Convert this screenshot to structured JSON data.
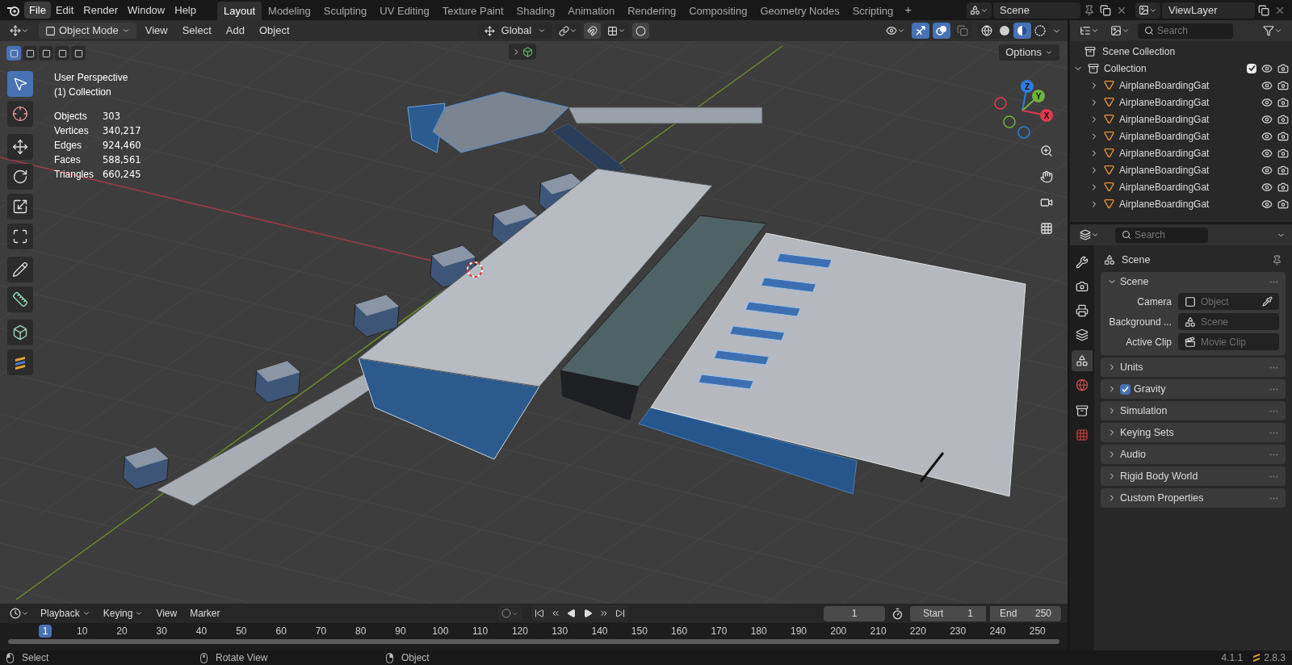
{
  "topbar": {
    "menus": [
      {
        "label": "File",
        "selected": true
      },
      {
        "label": "Edit",
        "selected": false
      },
      {
        "label": "Render",
        "selected": false
      },
      {
        "label": "Window",
        "selected": false
      },
      {
        "label": "Help",
        "selected": false
      }
    ],
    "workspaces": [
      {
        "label": "Layout",
        "selected": true
      },
      {
        "label": "Modeling",
        "selected": false
      },
      {
        "label": "Sculpting",
        "selected": false
      },
      {
        "label": "UV Editing",
        "selected": false
      },
      {
        "label": "Texture Paint",
        "selected": false
      },
      {
        "label": "Shading",
        "selected": false
      },
      {
        "label": "Animation",
        "selected": false
      },
      {
        "label": "Rendering",
        "selected": false
      },
      {
        "label": "Compositing",
        "selected": false
      },
      {
        "label": "Geometry Nodes",
        "selected": false
      },
      {
        "label": "Scripting",
        "selected": false
      }
    ],
    "add_tab": "+",
    "scene": "Scene",
    "view_layer": "ViewLayer"
  },
  "viewport": {
    "mode": "Object Mode",
    "menus": [
      "View",
      "Select",
      "Add",
      "Object"
    ],
    "orientation": "Global",
    "options": "Options",
    "select_modes": [
      {
        "selected": true
      },
      {
        "selected": false
      },
      {
        "selected": false
      },
      {
        "selected": false
      },
      {
        "selected": false
      }
    ],
    "toggles": [
      {
        "kind": "gizmo",
        "on": true
      },
      {
        "kind": "overlay",
        "on": true
      },
      {
        "kind": "xray",
        "on": false
      }
    ],
    "shading_modes": [
      {
        "kind": "wireframe",
        "selected": false
      },
      {
        "kind": "solid",
        "selected": false
      },
      {
        "kind": "material",
        "selected": true
      },
      {
        "kind": "rendered",
        "selected": false
      }
    ],
    "info": [
      "User Perspective",
      "(1) Collection"
    ],
    "stats": [
      {
        "label": "Objects",
        "value": "303"
      },
      {
        "label": "Vertices",
        "value": "340,217"
      },
      {
        "label": "Edges",
        "value": "924,460"
      },
      {
        "label": "Faces",
        "value": "588,561"
      },
      {
        "label": "Triangles",
        "value": "660,245"
      }
    ],
    "gizmo_axes": [
      {
        "label": "Z",
        "color": "#2f7be0"
      },
      {
        "label": "Y",
        "color": "#6fb33a"
      },
      {
        "label": "X",
        "color": "#e0394f"
      }
    ],
    "tools": [
      {
        "kind": "select",
        "selected": true
      },
      {
        "kind": "cursor",
        "selected": false
      },
      {
        "kind": "move",
        "selected": false
      },
      {
        "kind": "rotate",
        "selected": false
      },
      {
        "kind": "scale",
        "selected": false
      },
      {
        "kind": "transform",
        "selected": false
      },
      {
        "kind": "annotate",
        "selected": false
      },
      {
        "kind": "measure",
        "selected": false
      },
      {
        "kind": "add-cube",
        "selected": false
      },
      {
        "kind": "grease",
        "selected": false
      }
    ]
  },
  "outliner": {
    "search_placeholder": "Search",
    "root": "Scene Collection",
    "collection": {
      "name": "Collection",
      "expanded": true,
      "checked": true,
      "children": [
        {
          "name": "AirplaneBoardingGat",
          "expanded": false
        },
        {
          "name": "AirplaneBoardingGat",
          "expanded": false
        },
        {
          "name": "AirplaneBoardingGat",
          "expanded": false
        },
        {
          "name": "AirplaneBoardingGat",
          "expanded": false
        },
        {
          "name": "AirplaneBoardingGat",
          "expanded": false
        },
        {
          "name": "AirplaneBoardingGat",
          "expanded": false
        },
        {
          "name": "AirplaneBoardingGat",
          "expanded": false
        },
        {
          "name": "AirplaneBoardingGat",
          "expanded": false
        }
      ]
    }
  },
  "properties": {
    "search_placeholder": "Search",
    "title": "Scene",
    "tabs": [
      {
        "kind": "tool",
        "selected": false
      },
      {
        "kind": "render",
        "selected": false
      },
      {
        "kind": "output",
        "selected": false
      },
      {
        "kind": "view-layer",
        "selected": false
      },
      {
        "kind": "scene",
        "selected": true
      },
      {
        "kind": "world",
        "selected": false
      },
      {
        "kind": "collection",
        "selected": false
      },
      {
        "kind": "texture",
        "selected": false
      }
    ],
    "panels": [
      {
        "title": "Scene",
        "expanded": true,
        "fields": [
          {
            "label": "Camera",
            "placeholder": "Object",
            "kind": "object"
          },
          {
            "label": "Background ...",
            "placeholder": "Scene",
            "kind": "scene"
          },
          {
            "label": "Active Clip",
            "placeholder": "Movie Clip",
            "kind": "clip"
          }
        ]
      },
      {
        "title": "Units",
        "expanded": false
      },
      {
        "title": "Gravity",
        "expanded": false,
        "checked": true
      },
      {
        "title": "Simulation",
        "expanded": false
      },
      {
        "title": "Keying Sets",
        "expanded": false
      },
      {
        "title": "Audio",
        "expanded": false
      },
      {
        "title": "Rigid Body World",
        "expanded": false
      },
      {
        "title": "Custom Properties",
        "expanded": false
      }
    ]
  },
  "timeline": {
    "menus": [
      "Playback",
      "Keying",
      "View",
      "Marker"
    ],
    "current_frame": "1",
    "start_label": "Start",
    "start": "1",
    "end_label": "End",
    "end": "250",
    "ruler": [
      {
        "label": "1",
        "current": true
      },
      {
        "label": "10",
        "current": false
      },
      {
        "label": "20",
        "current": false
      },
      {
        "label": "30",
        "current": false
      },
      {
        "label": "40",
        "current": false
      },
      {
        "label": "50",
        "current": false
      },
      {
        "label": "60",
        "current": false
      },
      {
        "label": "70",
        "current": false
      },
      {
        "label": "80",
        "current": false
      },
      {
        "label": "90",
        "current": false
      },
      {
        "label": "100",
        "current": false
      },
      {
        "label": "110",
        "current": false
      },
      {
        "label": "120",
        "current": false
      },
      {
        "label": "130",
        "current": false
      },
      {
        "label": "140",
        "current": false
      },
      {
        "label": "150",
        "current": false
      },
      {
        "label": "160",
        "current": false
      },
      {
        "label": "170",
        "current": false
      },
      {
        "label": "180",
        "current": false
      },
      {
        "label": "190",
        "current": false
      },
      {
        "label": "200",
        "current": false
      },
      {
        "label": "210",
        "current": false
      },
      {
        "label": "220",
        "current": false
      },
      {
        "label": "230",
        "current": false
      },
      {
        "label": "240",
        "current": false
      },
      {
        "label": "250",
        "current": false
      }
    ]
  },
  "status_bar": {
    "items": [
      {
        "kind": "left-click",
        "label": "Select"
      },
      {
        "kind": "middle-click",
        "label": "Rotate View"
      },
      {
        "kind": "right-click",
        "label": "Object"
      }
    ],
    "version": "4.1.1",
    "addon_version": "2.8.3"
  }
}
